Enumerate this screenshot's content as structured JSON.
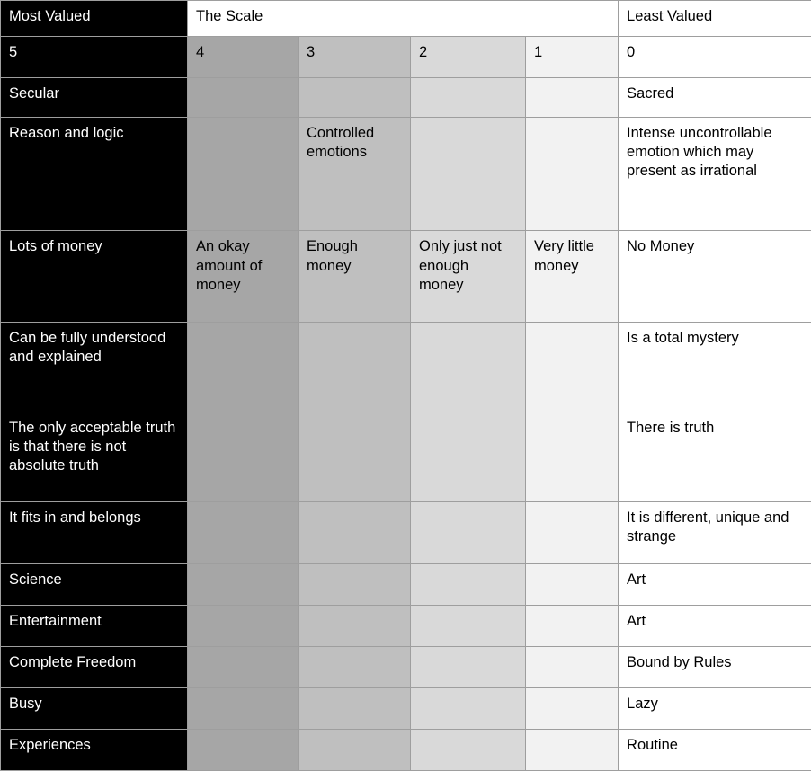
{
  "table": {
    "header": {
      "most_valued": "Most Valued",
      "scale": "The Scale",
      "least_valued": "Least Valued"
    },
    "scale_numbers": {
      "n5": "5",
      "n4": "4",
      "n3": "3",
      "n2": "2",
      "n1": "1",
      "n0": "0"
    },
    "colors": {
      "most_valued_bg": "#000000",
      "most_valued_text": "#ffffff",
      "col4_bg": "#a6a6a6",
      "col3_bg": "#bfbfbf",
      "col2_bg": "#d9d9d9",
      "col1_bg": "#f2f2f2",
      "col0_bg": "#ffffff",
      "border": "#9e9e9e"
    },
    "rows": [
      {
        "most_valued": "Secular",
        "col4": "",
        "col3": "",
        "col2": "",
        "col1": "",
        "least_valued": "Sacred"
      },
      {
        "most_valued": "Reason and logic",
        "col4": "",
        "col3": "Controlled emotions",
        "col2": "",
        "col1": "",
        "least_valued": "Intense uncontrollable emotion which may present as irrational"
      },
      {
        "most_valued": "Lots of money",
        "col4": "An okay amount of money",
        "col3": "Enough money",
        "col2": "Only just not enough money",
        "col1": "Very little money",
        "least_valued": "No Money"
      },
      {
        "most_valued": "Can be fully understood and explained",
        "col4": "",
        "col3": "",
        "col2": "",
        "col1": "",
        "least_valued": "Is a total mystery"
      },
      {
        "most_valued": "The only acceptable truth is that there is not absolute truth",
        "col4": "",
        "col3": "",
        "col2": "",
        "col1": "",
        "least_valued": "There is truth"
      },
      {
        "most_valued": "It fits in and belongs",
        "col4": "",
        "col3": "",
        "col2": "",
        "col1": "",
        "least_valued": "It is different, unique and strange"
      },
      {
        "most_valued": "Science",
        "col4": "",
        "col3": "",
        "col2": "",
        "col1": "",
        "least_valued": "Art"
      },
      {
        "most_valued": "Entertainment",
        "col4": "",
        "col3": "",
        "col2": "",
        "col1": "",
        "least_valued": "Art"
      },
      {
        "most_valued": "Complete Freedom",
        "col4": "",
        "col3": "",
        "col2": "",
        "col1": "",
        "least_valued": "Bound by Rules"
      },
      {
        "most_valued": "Busy",
        "col4": "",
        "col3": "",
        "col2": "",
        "col1": "",
        "least_valued": "Lazy"
      },
      {
        "most_valued": "Experiences",
        "col4": "",
        "col3": "",
        "col2": "",
        "col1": "",
        "least_valued": "Routine"
      }
    ]
  }
}
